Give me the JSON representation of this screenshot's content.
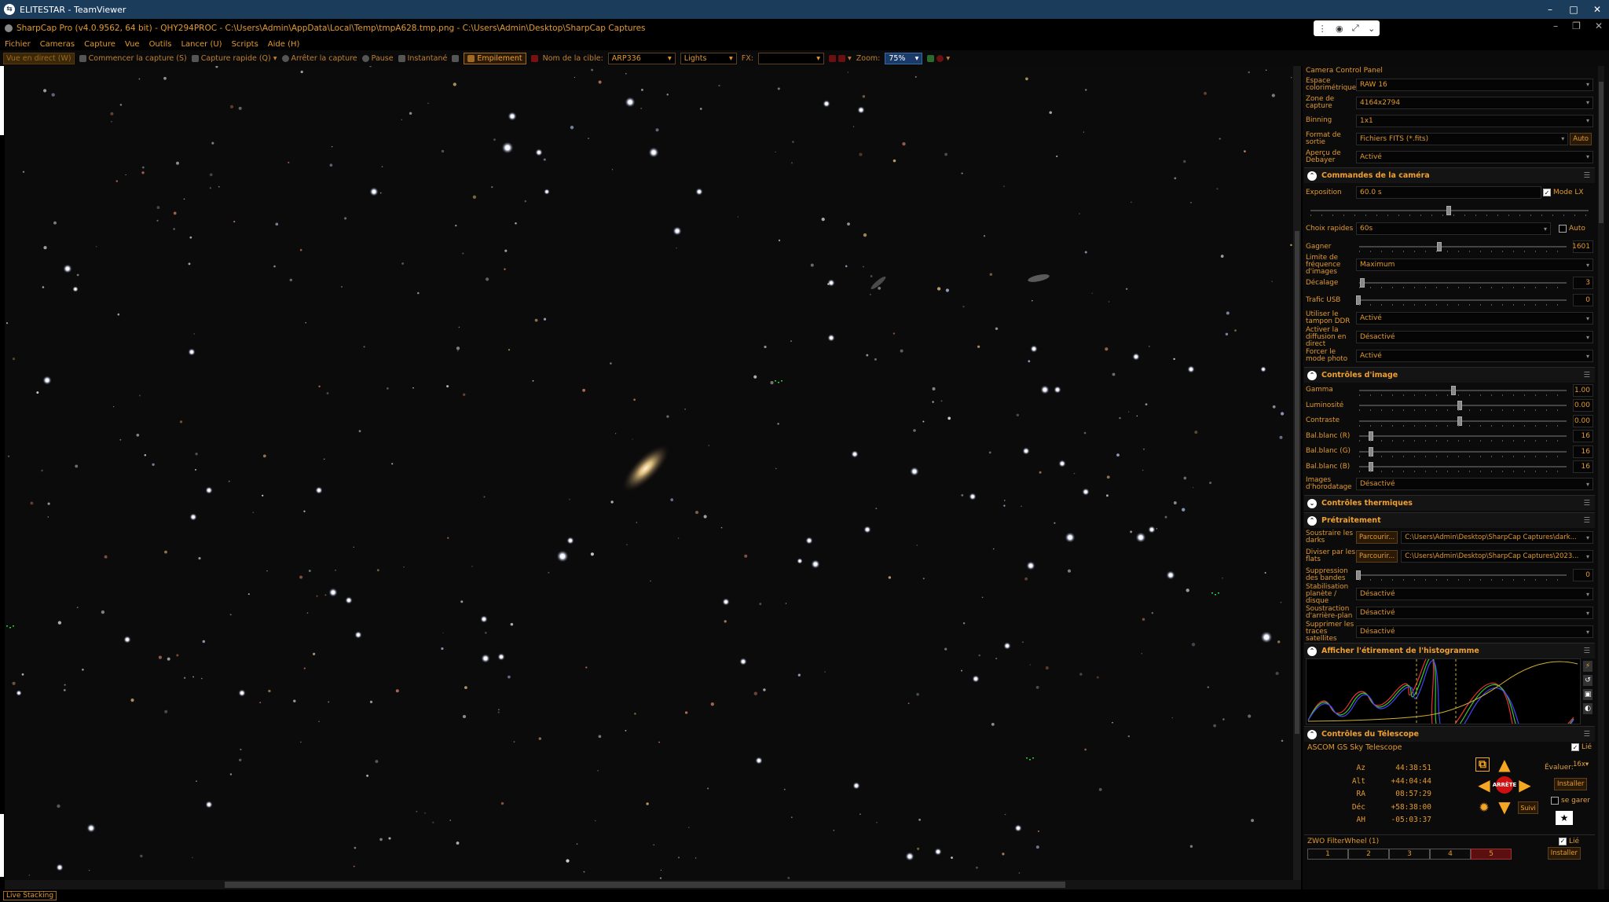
{
  "teamviewer": {
    "title": "ELITESTAR - TeamViewer",
    "logo": "teamviewer-logo-icon"
  },
  "app": {
    "title": "SharpCap Pro (v4.0.9562, 64 bit) - QHY294PROC - C:\\Users\\Admin\\AppData\\Local\\Temp\\tmpA628.tmp.png - C:\\Users\\Admin\\Desktop\\SharpCap Captures"
  },
  "menu": [
    "Fichier",
    "Cameras",
    "Capture",
    "Vue",
    "Outils",
    "Lancer (U)",
    "Scripts",
    "Aide (H)"
  ],
  "toolbar": {
    "live_view": "Vue en direct (W)",
    "start_capture": "Commencer la capture (S)",
    "quick_capture": "Capture rapide (Q)",
    "stop_capture": "Arrêter la capture",
    "pause": "Pause",
    "snapshot": "Instantané",
    "stacking": "Empilement",
    "target_label": "Nom de la cible:",
    "target_value": "ARP336",
    "frame_type": "Lights",
    "fx_label": "FX:",
    "fx_value": "",
    "zoom_label": "Zoom:",
    "zoom_value": "75%"
  },
  "status": {
    "live_stacking": "Live Stacking"
  },
  "panel": {
    "title": "Camera Control Panel",
    "top_rows": [
      {
        "label": "Espace colorimétrique",
        "value": "RAW 16"
      },
      {
        "label": "Zone de capture",
        "value": "4164x2794"
      },
      {
        "label": "Binning",
        "value": "1x1"
      },
      {
        "label": "Format de sortie",
        "value": "Fichiers FITS (*.fits)",
        "button": "Auto"
      },
      {
        "label": "Aperçu de Debayer",
        "value": "Activé"
      }
    ],
    "camera_controls": {
      "header": "Commandes de la caméra",
      "exposure_label": "Exposition",
      "exposure_value": "60.0 s",
      "lx_mode": "Mode LX",
      "quick_choice_label": "Choix rapides",
      "quick_choice_value": "60s",
      "auto": "Auto",
      "gain_label": "Gagner",
      "gain_value": "1601",
      "gain_fraction": 0.4,
      "frame_limit_label": "Limite de fréquence d'images",
      "frame_limit_value": "Maximum",
      "offset_label": "Décalage",
      "offset_value": "3",
      "offset_fraction": 0.02,
      "usb_label": "Trafic USB",
      "usb_value": "0",
      "usb_fraction": 0.0,
      "ddr_label": "Utiliser le tampon DDR",
      "ddr_value": "Activé",
      "stream_label": "Activer la diffusion en direct",
      "stream_value": "Désactivé",
      "photo_label": "Forcer le mode photo",
      "photo_value": "Activé"
    },
    "image_controls": {
      "header": "Contrôles d'image",
      "sliders": [
        {
          "label": "Gamma",
          "value": "1.00",
          "fraction": 0.47
        },
        {
          "label": "Luminosité",
          "value": "0.00",
          "fraction": 0.5
        },
        {
          "label": "Contraste",
          "value": "0.00",
          "fraction": 0.5
        },
        {
          "label": "Bal.blanc (R)",
          "value": "16",
          "fraction": 0.06
        },
        {
          "label": "Bal.blanc (G)",
          "value": "16",
          "fraction": 0.06
        },
        {
          "label": "Bal.blanc (B)",
          "value": "16",
          "fraction": 0.06
        }
      ],
      "timestamp_label": "Images d'horodatage",
      "timestamp_value": "Désactivé"
    },
    "thermal": {
      "header": "Contrôles thermiques"
    },
    "preprocessing": {
      "header": "Prétraitement",
      "darks_label": "Soustraire les darks",
      "darks_button": "Parcourir...",
      "darks_path": "C:\\Users\\Admin\\Desktop\\SharpCap Captures\\dark...",
      "flats_label": "Diviser par les flats",
      "flats_button": "Parcourir...",
      "flats_path": "C:\\Users\\Admin\\Desktop\\SharpCap Captures\\2023...",
      "banding_label": "Suppression des bandes",
      "banding_value": "0",
      "stab_label": "Stabilisation planète / disque",
      "stab_value": "Désactivé",
      "bg_label": "Soustraction d'arrière-plan",
      "bg_value": "Désactivé",
      "sat_label": "Supprimer les traces satellites",
      "sat_value": "Désactivé"
    },
    "histogram": {
      "header": "Afficher l'étirement de l'histogramme"
    },
    "telescope": {
      "header": "Contrôles du Télescope",
      "mount": "ASCOM GS Sky Telescope",
      "linked": "Lié",
      "coords": [
        {
          "k": "Az",
          "v": "44:38:51"
        },
        {
          "k": "Alt",
          "v": "+44:04:44"
        },
        {
          "k": "RA",
          "v": "08:57:29"
        },
        {
          "k": "Déc",
          "v": "+58:38:00"
        },
        {
          "k": "AH",
          "v": "-05:03:37"
        }
      ],
      "rate_label": "Évaluer:",
      "rate_value": "16x",
      "install": "Installer",
      "park": "se garer",
      "stop": "ARRÊTE",
      "track": "Suivi"
    },
    "filterwheel": {
      "name": "ZWO FilterWheel (1)",
      "linked": "Lié",
      "slots": [
        "1",
        "2",
        "3",
        "4",
        "5"
      ],
      "selected": "5",
      "install": "Installer"
    }
  }
}
